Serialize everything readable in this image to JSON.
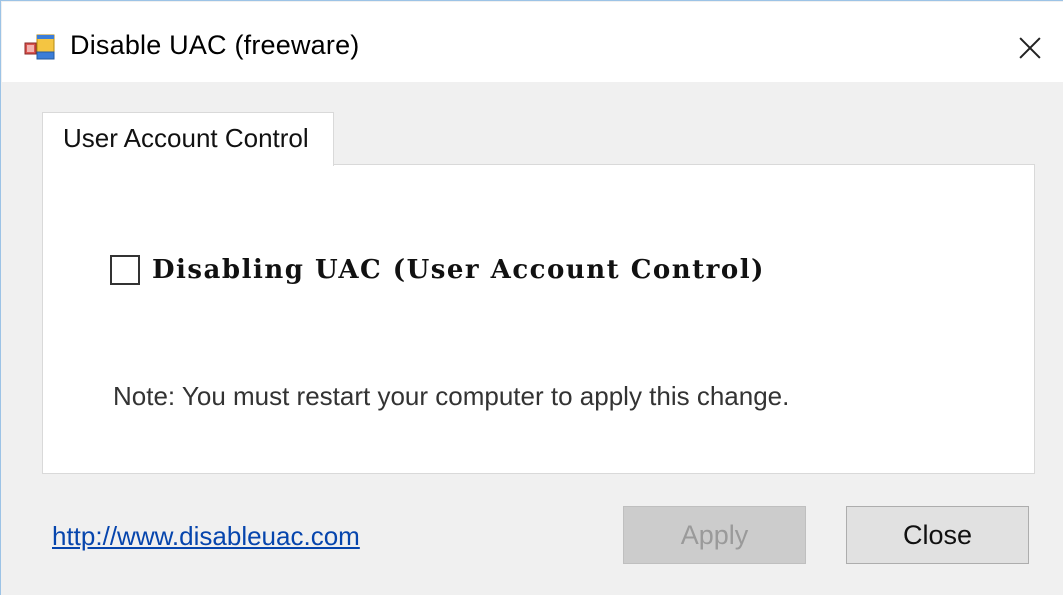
{
  "window": {
    "title": "Disable UAC (freeware)",
    "app_icon": "windows-app-icon",
    "close_icon": "close-icon"
  },
  "tabs": [
    {
      "label": "User Account Control",
      "active": true
    }
  ],
  "panel": {
    "checkbox": {
      "label": "Disabling UAC (User Account Control)",
      "checked": false
    },
    "note": "Note: You must restart your computer to apply this change."
  },
  "footer": {
    "link_text": "http://www.disableuac.com",
    "apply_label": "Apply",
    "apply_enabled": false,
    "close_label": "Close"
  },
  "colors": {
    "accent_border": "#9cc3e6",
    "link": "#0645ad",
    "disabled_button": "#cccccc"
  }
}
